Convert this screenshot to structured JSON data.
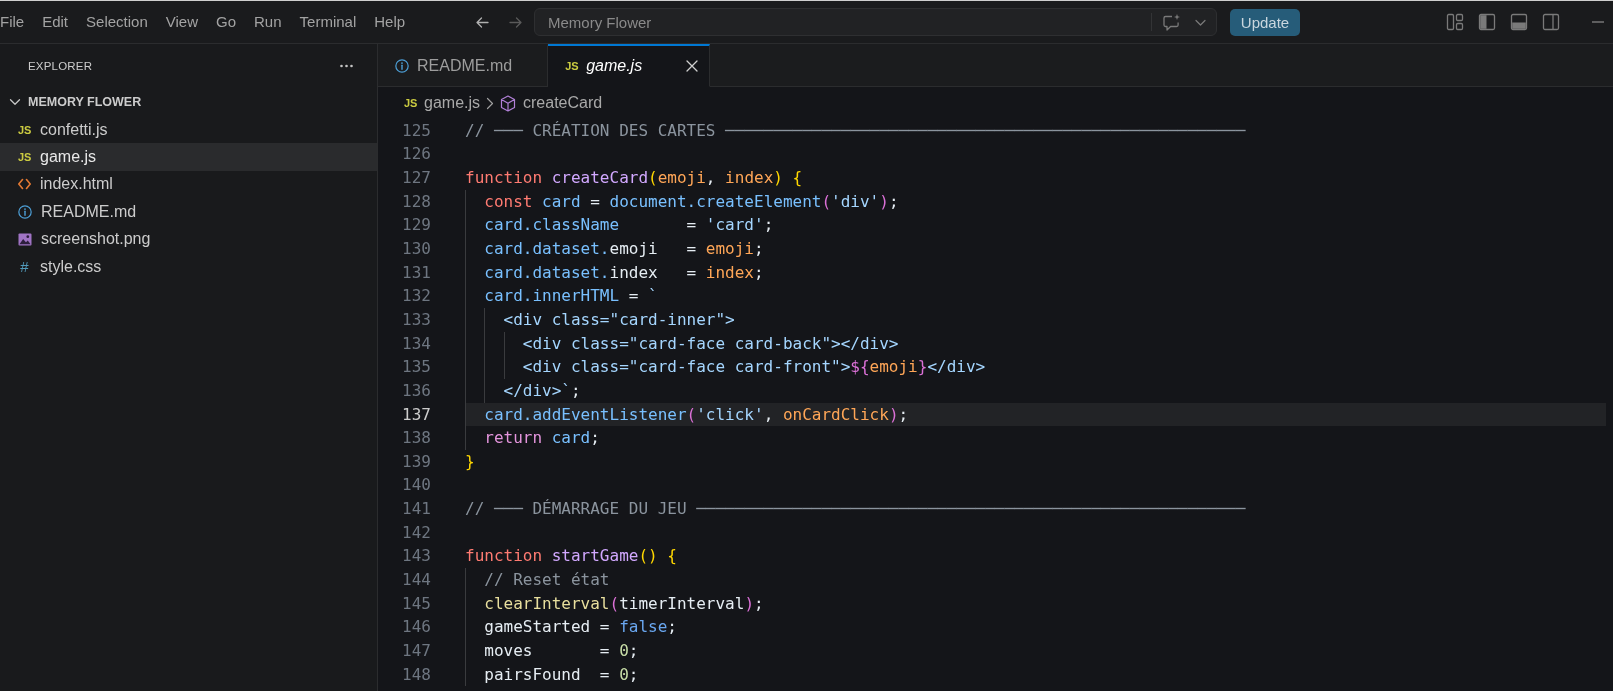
{
  "title_bar": {
    "menu": [
      "File",
      "Edit",
      "Selection",
      "View",
      "Go",
      "Run",
      "Terminal",
      "Help"
    ],
    "navigation": [
      {
        "kind": "back",
        "disabled": false
      },
      {
        "kind": "forward",
        "disabled": true
      }
    ],
    "command_center": {
      "value": "Memory Flower"
    },
    "update_button": "Update"
  },
  "sidebar": {
    "title": "EXPLORER",
    "folder": {
      "name": "MEMORY FLOWER",
      "expanded": true,
      "children": [
        {
          "name": "confetti.js",
          "kind": "js",
          "badge": "JS",
          "selected": false
        },
        {
          "name": "game.js",
          "kind": "js",
          "badge": "JS",
          "selected": true
        },
        {
          "name": "index.html",
          "kind": "html",
          "selected": false
        },
        {
          "name": "README.md",
          "kind": "info",
          "selected": false
        },
        {
          "name": "screenshot.png",
          "kind": "image",
          "selected": false
        },
        {
          "name": "style.css",
          "kind": "css",
          "badge": "#",
          "selected": false
        }
      ]
    }
  },
  "editor": {
    "tabs": [
      {
        "label": "README.md",
        "kind": "info",
        "selected": false,
        "preview": false
      },
      {
        "label": "game.js",
        "kind": "js",
        "badge": "JS",
        "selected": true,
        "preview": true
      }
    ],
    "breadcrumb": [
      {
        "label": "game.js",
        "kind": "js",
        "badge": "JS"
      },
      {
        "label": "createCard",
        "kind": "symbol"
      }
    ],
    "lines": [
      {
        "number": "125",
        "current": false,
        "tokens": [
          {
            "text": "// ─── CRÉATION DES CARTES ──────────────────────────────────────────────────────",
            "kind": "comment"
          }
        ]
      },
      {
        "number": "126",
        "current": false
      },
      {
        "number": "127",
        "current": false,
        "tokens": [
          {
            "text": "function ",
            "kind": "keyword"
          },
          {
            "text": "createCard",
            "kind": "function"
          },
          {
            "text": "(",
            "kind": "bracket1"
          },
          {
            "text": "emoji",
            "kind": "param"
          },
          {
            "text": ", ",
            "kind": "plain"
          },
          {
            "text": "index",
            "kind": "param"
          },
          {
            "text": ") {",
            "kind": "bracket1"
          }
        ]
      },
      {
        "number": "128",
        "current": false,
        "tokens": [
          {
            "text": "  const ",
            "kind": "keyword"
          },
          {
            "text": "card",
            "kind": "variable"
          },
          {
            "text": " = ",
            "kind": "plain"
          },
          {
            "text": "document.createElement",
            "kind": "variable"
          },
          {
            "text": "(",
            "kind": "bracket2"
          },
          {
            "text": "'div'",
            "kind": "string"
          },
          {
            "text": ")",
            "kind": "bracket2"
          },
          {
            "text": ";",
            "kind": "plain"
          }
        ]
      },
      {
        "number": "129",
        "current": false,
        "tokens": [
          {
            "text": "  card.className",
            "kind": "variable"
          },
          {
            "text": "       = ",
            "kind": "plain"
          },
          {
            "text": "'card'",
            "kind": "string"
          },
          {
            "text": ";",
            "kind": "plain"
          }
        ]
      },
      {
        "number": "130",
        "current": false,
        "tokens": [
          {
            "text": "  card.dataset.",
            "kind": "variable"
          },
          {
            "text": "emoji   = ",
            "kind": "plain"
          },
          {
            "text": "emoji",
            "kind": "param"
          },
          {
            "text": ";",
            "kind": "plain"
          }
        ]
      },
      {
        "number": "131",
        "current": false,
        "tokens": [
          {
            "text": "  card.dataset.",
            "kind": "variable"
          },
          {
            "text": "index   = ",
            "kind": "plain"
          },
          {
            "text": "index",
            "kind": "param"
          },
          {
            "text": ";",
            "kind": "plain"
          }
        ]
      },
      {
        "number": "132",
        "current": false,
        "tokens": [
          {
            "text": "  card.innerHTML",
            "kind": "variable"
          },
          {
            "text": " = ",
            "kind": "plain"
          },
          {
            "text": "`",
            "kind": "string"
          }
        ]
      },
      {
        "number": "133",
        "current": false,
        "tokens": [
          {
            "text": "    <div class=\"card-inner\">",
            "kind": "string"
          }
        ]
      },
      {
        "number": "134",
        "current": false,
        "tokens": [
          {
            "text": "      <div class=\"card-face card-back\"></div>",
            "kind": "string"
          }
        ]
      },
      {
        "number": "135",
        "current": false,
        "tokens": [
          {
            "text": "      <div class=\"card-face card-front\">",
            "kind": "string"
          },
          {
            "text": "${",
            "kind": "bracket2"
          },
          {
            "text": "emoji",
            "kind": "param"
          },
          {
            "text": "}",
            "kind": "bracket2"
          },
          {
            "text": "</div>",
            "kind": "string"
          }
        ]
      },
      {
        "number": "136",
        "current": false,
        "tokens": [
          {
            "text": "    </div>`",
            "kind": "string"
          },
          {
            "text": ";",
            "kind": "plain"
          }
        ]
      },
      {
        "number": "137",
        "current": true,
        "tokens": [
          {
            "text": "  card.addEventListener",
            "kind": "variable"
          },
          {
            "text": "(",
            "kind": "bracket2"
          },
          {
            "text": "'click'",
            "kind": "string"
          },
          {
            "text": ", ",
            "kind": "plain"
          },
          {
            "text": "onCardClick",
            "kind": "param"
          },
          {
            "text": ")",
            "kind": "bracket2"
          },
          {
            "text": ";",
            "kind": "plain"
          }
        ]
      },
      {
        "number": "138",
        "current": false,
        "tokens": [
          {
            "text": "  return ",
            "kind": "control"
          },
          {
            "text": "card",
            "kind": "variable"
          },
          {
            "text": ";",
            "kind": "plain"
          }
        ]
      },
      {
        "number": "139",
        "current": false,
        "tokens": [
          {
            "text": "}",
            "kind": "bracket1"
          }
        ]
      },
      {
        "number": "140",
        "current": false
      },
      {
        "number": "141",
        "current": false,
        "tokens": [
          {
            "text": "// ─── DÉMARRAGE DU JEU ─────────────────────────────────────────────────────────",
            "kind": "comment"
          }
        ]
      },
      {
        "number": "142",
        "current": false
      },
      {
        "number": "143",
        "current": false,
        "tokens": [
          {
            "text": "function ",
            "kind": "keyword"
          },
          {
            "text": "startGame",
            "kind": "function"
          },
          {
            "text": "() {",
            "kind": "bracket1"
          }
        ]
      },
      {
        "number": "144",
        "current": false,
        "tokens": [
          {
            "text": "  // Reset état",
            "kind": "comment"
          }
        ]
      },
      {
        "number": "145",
        "current": false,
        "tokens": [
          {
            "text": "  clearInterval",
            "kind": "call"
          },
          {
            "text": "(",
            "kind": "bracket2"
          },
          {
            "text": "timerInterval",
            "kind": "plain"
          },
          {
            "text": ")",
            "kind": "bracket2"
          },
          {
            "text": ";",
            "kind": "plain"
          }
        ]
      },
      {
        "number": "146",
        "current": false,
        "tokens": [
          {
            "text": "  gameStarted = ",
            "kind": "plain"
          },
          {
            "text": "false",
            "kind": "constant"
          },
          {
            "text": ";",
            "kind": "plain"
          }
        ]
      },
      {
        "number": "147",
        "current": false,
        "tokens": [
          {
            "text": "  moves       = ",
            "kind": "plain"
          },
          {
            "text": "0",
            "kind": "number"
          },
          {
            "text": ";",
            "kind": "plain"
          }
        ]
      },
      {
        "number": "148",
        "current": false,
        "tokens": [
          {
            "text": "  pairsFound  = ",
            "kind": "plain"
          },
          {
            "text": "0",
            "kind": "number"
          },
          {
            "text": ";",
            "kind": "plain"
          }
        ]
      }
    ]
  }
}
